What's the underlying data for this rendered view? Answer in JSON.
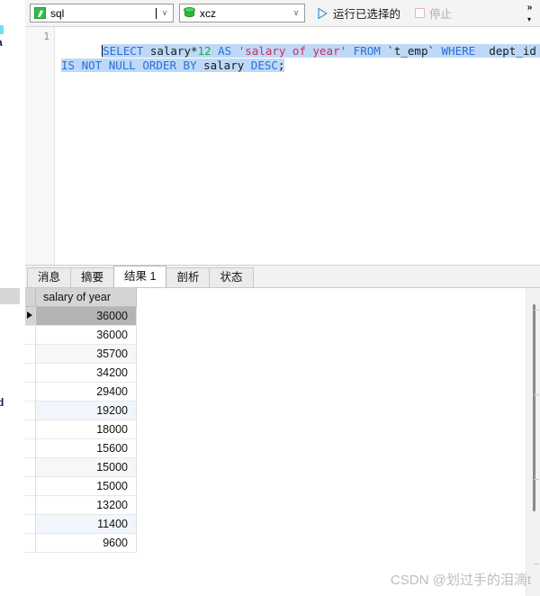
{
  "toolbar": {
    "sql_combo": {
      "icon": "sql-file-icon",
      "value": "sql",
      "arrow": "∨"
    },
    "db_combo": {
      "icon": "database-icon",
      "value": "xcz",
      "arrow": "∨"
    },
    "run_button": {
      "icon": "play-icon",
      "label": "运行已选择的"
    },
    "stop_button": {
      "icon": "stop-icon",
      "label": "停止",
      "enabled": false
    },
    "overflow": {
      "chevrons": "»",
      "down": "▾"
    }
  },
  "editor": {
    "line_numbers": [
      "1"
    ],
    "sql_text": "SELECT salary*12 AS 'salary of year' FROM `t_emp` WHERE  dept_id IS NOT NULL ORDER BY salary DESC;",
    "tokens": [
      {
        "t": "SELECT",
        "c": "kw"
      },
      {
        "t": " ",
        "c": "op"
      },
      {
        "t": "salary",
        "c": "id"
      },
      {
        "t": "*",
        "c": "op"
      },
      {
        "t": "12",
        "c": "num"
      },
      {
        "t": " ",
        "c": "op"
      },
      {
        "t": "AS",
        "c": "kw"
      },
      {
        "t": " ",
        "c": "op"
      },
      {
        "t": "'salary of year'",
        "c": "str"
      },
      {
        "t": " ",
        "c": "op"
      },
      {
        "t": "FROM",
        "c": "kw"
      },
      {
        "t": " ",
        "c": "op"
      },
      {
        "t": "`t_emp`",
        "c": "tick"
      },
      {
        "t": " ",
        "c": "op"
      },
      {
        "t": "WHERE",
        "c": "kw"
      },
      {
        "t": "  ",
        "c": "op"
      },
      {
        "t": "dept_id",
        "c": "id"
      },
      {
        "t": " ",
        "c": "op"
      },
      {
        "t": "IS",
        "c": "kw"
      },
      {
        "t": " ",
        "c": "op"
      },
      {
        "t": "NOT",
        "c": "kw"
      },
      {
        "t": " ",
        "c": "op"
      },
      {
        "t": "NULL",
        "c": "kw"
      },
      {
        "t": " ",
        "c": "op"
      },
      {
        "t": "ORDER",
        "c": "kw"
      },
      {
        "t": " ",
        "c": "op"
      },
      {
        "t": "BY",
        "c": "kw"
      },
      {
        "t": " ",
        "c": "op"
      },
      {
        "t": "salary",
        "c": "id"
      },
      {
        "t": " ",
        "c": "op"
      },
      {
        "t": "DESC",
        "c": "kw"
      },
      {
        "t": ";",
        "c": "op"
      }
    ],
    "selection_color": "#bdd9f7"
  },
  "result_tabs": {
    "items": [
      {
        "label": "消息",
        "active": false
      },
      {
        "label": "摘要",
        "active": false
      },
      {
        "label": "结果 1",
        "active": true
      },
      {
        "label": "剖析",
        "active": false
      },
      {
        "label": "状态",
        "active": false
      }
    ]
  },
  "grid": {
    "columns": [
      "salary of year"
    ],
    "rows": [
      {
        "value": "36000",
        "selected": true,
        "tint": ""
      },
      {
        "value": "36000",
        "selected": false,
        "tint": ""
      },
      {
        "value": "35700",
        "selected": false,
        "tint": "tint-a"
      },
      {
        "value": "34200",
        "selected": false,
        "tint": ""
      },
      {
        "value": "29400",
        "selected": false,
        "tint": ""
      },
      {
        "value": "19200",
        "selected": false,
        "tint": "tint-b"
      },
      {
        "value": "18000",
        "selected": false,
        "tint": ""
      },
      {
        "value": "15600",
        "selected": false,
        "tint": ""
      },
      {
        "value": "15000",
        "selected": false,
        "tint": "tint-a"
      },
      {
        "value": "15000",
        "selected": false,
        "tint": ""
      },
      {
        "value": "13200",
        "selected": false,
        "tint": ""
      },
      {
        "value": "11400",
        "selected": false,
        "tint": "tint-b"
      },
      {
        "value": "9600",
        "selected": false,
        "tint": ""
      }
    ],
    "selected_row_marker": "▶"
  },
  "left_fragments": {
    "top_text": "a",
    "mid_text": "d"
  },
  "watermark": {
    "text": "CSDN @划过手的泪滴t"
  },
  "colors": {
    "accent_green": "#2fc04a",
    "play_blue": "#3b9bd4",
    "selection_blue": "#bdd9f7",
    "header_gray": "#d4d4d4",
    "selected_row_gray": "#b4b4b4"
  }
}
